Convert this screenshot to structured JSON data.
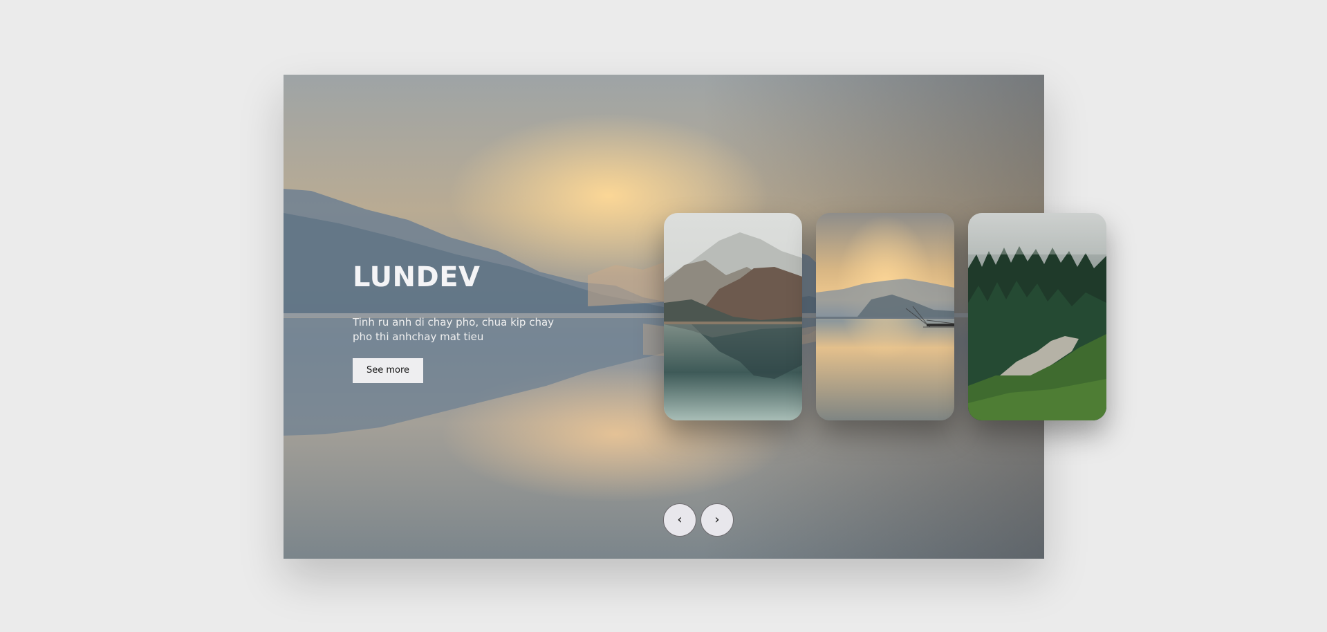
{
  "slider": {
    "title": "LUNDEV",
    "description": "Tinh ru anh di chay pho, chua kip chay pho thi anhchay mat tieu",
    "see_more_label": "See more",
    "prev_icon": "chevron-left-icon",
    "next_icon": "chevron-right-icon",
    "prev_glyph": "‹",
    "next_glyph": "›"
  },
  "thumbnails": [
    {
      "scene": "misty mountain lake"
    },
    {
      "scene": "sunrise over lake with fishing net"
    },
    {
      "scene": "foggy pine forest"
    }
  ],
  "colors": {
    "page_background": "#ebebeb",
    "button_background": "#eeeef0",
    "title_text": "#f4f4f6"
  }
}
